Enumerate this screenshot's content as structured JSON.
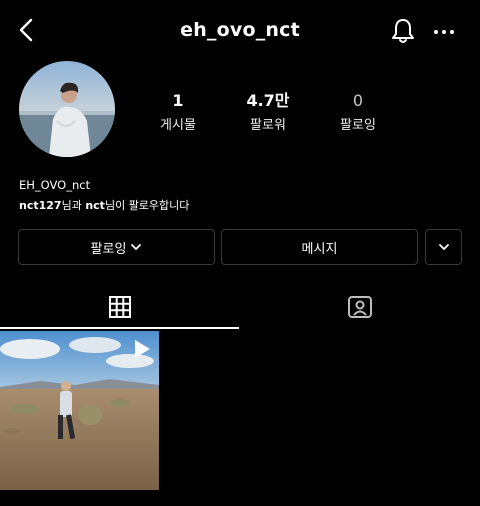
{
  "header": {
    "username": "eh_ovo_nct"
  },
  "profile": {
    "stats": [
      {
        "value": "1",
        "label": "게시물"
      },
      {
        "value": "4.7만",
        "label": "팔로워"
      },
      {
        "value": "0",
        "label": "팔로잉"
      }
    ],
    "display_name": "EH_OVO_nct",
    "followed_by": {
      "name1": "nct127",
      "mid": "님과 ",
      "name2": "nct",
      "end": "님이 팔로우합니다"
    }
  },
  "actions": {
    "following_label": "팔로잉",
    "message_label": "메시지"
  },
  "icons": {
    "back": "chevron-left-icon",
    "bell": "bell-icon",
    "more": "more-horizontal-icon",
    "grid": "grid-icon",
    "tagged": "tagged-user-icon",
    "video": "play-icon"
  },
  "colors": {
    "background": "#000000",
    "text": "#ffffff",
    "button_border": "#3a3a3a"
  }
}
